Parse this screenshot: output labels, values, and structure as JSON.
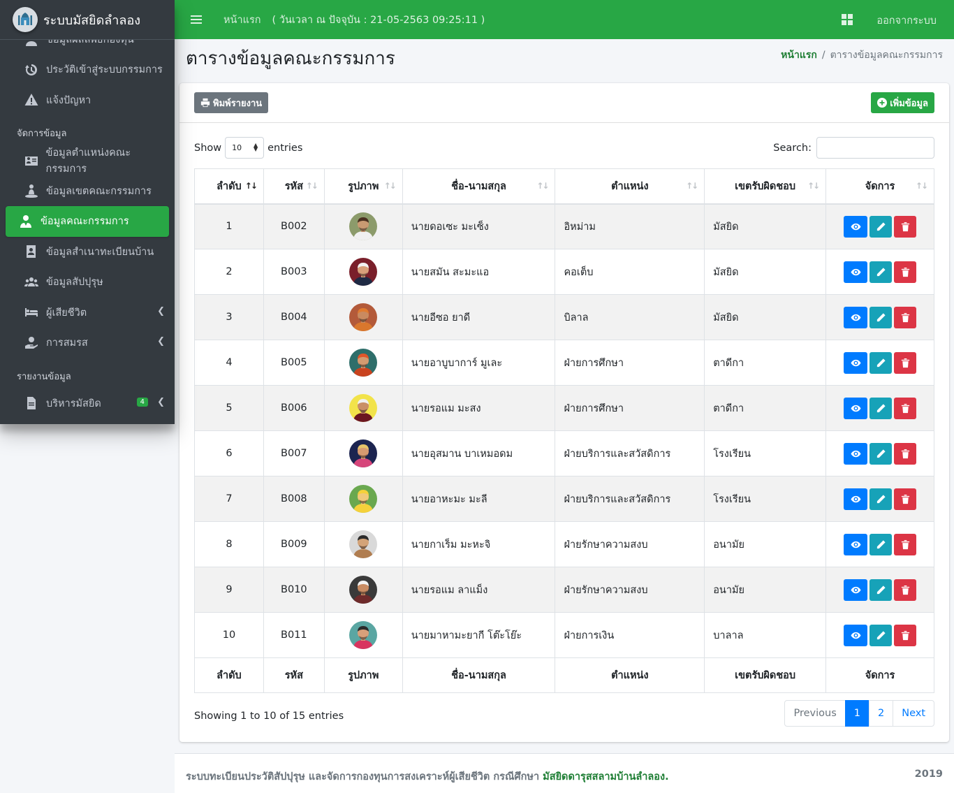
{
  "brand": {
    "name": "ระบบมัสยิดลำลอง"
  },
  "topbar": {
    "home": "หน้าแรก",
    "datetime": "( วันเวลา ณ ปัจจุบัน : 21-05-2563 09:25:11 )",
    "logout": "ออกจากระบบ"
  },
  "sidebar": {
    "items": [
      {
        "label": "ข้อมูลผลลัพธ์กองทุน",
        "icon": "user-icon"
      },
      {
        "label": "ประวัติเข้าสู่ระบบกรรมการ",
        "icon": "history-icon"
      },
      {
        "label": "แจ้งปัญหา",
        "icon": "warning-icon"
      },
      {
        "label": "ข้อมูลตำแหน่งคณะกรรมการ",
        "icon": "id-card-icon"
      },
      {
        "label": "ข้อมูลเขตคณะกรรมการ",
        "icon": "map-marker-user-icon"
      },
      {
        "label": "ข้อมูลคณะกรรมการ",
        "icon": "user-tie-icon"
      },
      {
        "label": "ข้อมูลสำเนาทะเบียนบ้าน",
        "icon": "address-book-icon"
      },
      {
        "label": "ข้อมูลสัปปุรุษ",
        "icon": "users-icon"
      },
      {
        "label": "ผู้เสียชีวิต",
        "icon": "bed-icon"
      },
      {
        "label": "การสมรส",
        "icon": "hand-holding-heart-icon"
      },
      {
        "label": "บริหารมัสยิด",
        "icon": "file-icon",
        "badge": "4"
      }
    ],
    "headers": {
      "manage": "จัดการข้อมูล",
      "report": "รายงานข้อมูล"
    }
  },
  "page": {
    "title": "ตารางข้อมูลคณะกรรมการ",
    "breadcrumb_home": "หน้าแรก",
    "breadcrumb_current": "ตารางข้อมูลคณะกรรมการ"
  },
  "toolbar": {
    "print": "พิมพ์รายงาน",
    "add": "เพิ่มข้อมูล"
  },
  "datatable": {
    "show": "Show",
    "entries": "entries",
    "length": "10",
    "search": "Search:",
    "columns": [
      "ลำดับ",
      "รหัส",
      "รูปภาพ",
      "ชื่อ-นามสกุล",
      "ตำแหน่ง",
      "เขตรับผิดชอบ",
      "จัดการ"
    ],
    "rows": [
      {
        "no": "1",
        "code": "B002",
        "name": "นายดอเซะ มะเซ็ง",
        "position": "อิหม่าม",
        "zone": "มัสยิด",
        "avatar": {
          "bg": "#8c9b6b",
          "skin": "#c99a72",
          "cloth": "#f0f0f0",
          "hair": "#4a3020"
        }
      },
      {
        "no": "2",
        "code": "B003",
        "name": "นายสมัน สะมะแอ",
        "position": "คอเต็บ",
        "zone": "มัสยิด",
        "avatar": {
          "bg": "#7a1f2a",
          "skin": "#d8a07a",
          "cloth": "#1f2a44",
          "hair": "#f2f2f2"
        }
      },
      {
        "no": "3",
        "code": "B004",
        "name": "นายอีซอ ยาดี",
        "position": "บิลาล",
        "zone": "มัสยิด",
        "avatar": {
          "bg": "#b35a3a",
          "skin": "#c98a60",
          "cloth": "#d9772d",
          "hair": "#e07b30"
        }
      },
      {
        "no": "4",
        "code": "B005",
        "name": "นายอาบูบาการ์ มูเละ",
        "position": "ฝ่ายการศึกษา",
        "zone": "ตาดีกา",
        "avatar": {
          "bg": "#2e6e6a",
          "skin": "#d39b70",
          "cloth": "#c9431f",
          "hair": "#e0562a"
        }
      },
      {
        "no": "5",
        "code": "B006",
        "name": "นายรอแม มะสง",
        "position": "ฝ่ายการศึกษา",
        "zone": "ตาดีกา",
        "avatar": {
          "bg": "#f2e34a",
          "skin": "#c98f66",
          "cloth": "#6b1620",
          "hair": "#f0f0f0"
        }
      },
      {
        "no": "6",
        "code": "B007",
        "name": "นายอุสมาน บาเหมอดม",
        "position": "ฝ่ายบริการและสวัสดิการ",
        "zone": "โรงเรียน",
        "avatar": {
          "bg": "#1c2450",
          "skin": "#d79a70",
          "cloth": "#d6457a",
          "hair": "#e5c36a"
        }
      },
      {
        "no": "7",
        "code": "B008",
        "name": "นายอาหะมะ มะลี",
        "position": "ฝ่ายบริการและสวัสดิการ",
        "zone": "โรงเรียน",
        "avatar": {
          "bg": "#6aa84f",
          "skin": "#f0c97a",
          "cloth": "#f5d13a",
          "hair": "#f5d13a"
        }
      },
      {
        "no": "8",
        "code": "B009",
        "name": "นายกาเร็ม มะหะจิ",
        "position": "ฝ่ายรักษาความสงบ",
        "zone": "อนามัย",
        "avatar": {
          "bg": "#d9d9d9",
          "skin": "#d3a378",
          "cloth": "#b07d50",
          "hair": "#2b2b2b"
        }
      },
      {
        "no": "9",
        "code": "B010",
        "name": "นายรอแม ลาแม็ง",
        "position": "ฝ่ายรักษาความสงบ",
        "zone": "อนามัย",
        "avatar": {
          "bg": "#3a3a3a",
          "skin": "#c98c63",
          "cloth": "#6e2b2b",
          "hair": "#f2f2f2"
        }
      },
      {
        "no": "10",
        "code": "B011",
        "name": "นายมาหามะยากี โต๊ะโย๊ะ",
        "position": "ฝ่ายการเงิน",
        "zone": "บาลาล",
        "avatar": {
          "bg": "#5aa6a2",
          "skin": "#d8a07a",
          "cloth": "#d8345f",
          "hair": "#2b2b2b"
        }
      }
    ],
    "info": "Showing 1 to 10 of 15 entries",
    "pager": {
      "prev": "Previous",
      "pages": [
        "1",
        "2"
      ],
      "next": "Next"
    }
  },
  "footer": {
    "text": "ระบบทะเบียนประวัติสัปปุรุษ และจัดการกองทุนการสงเคราะห์ผู้เสียชีวิต กรณีศึกษา",
    "link": "มัสยิดดารุสสลามบ้านลำลอง.",
    "year": "2019"
  },
  "colors": {
    "green": "#28a745",
    "sidebar": "#343a40",
    "primary": "#007bff",
    "info": "#17a2b8",
    "danger": "#dc3545"
  }
}
